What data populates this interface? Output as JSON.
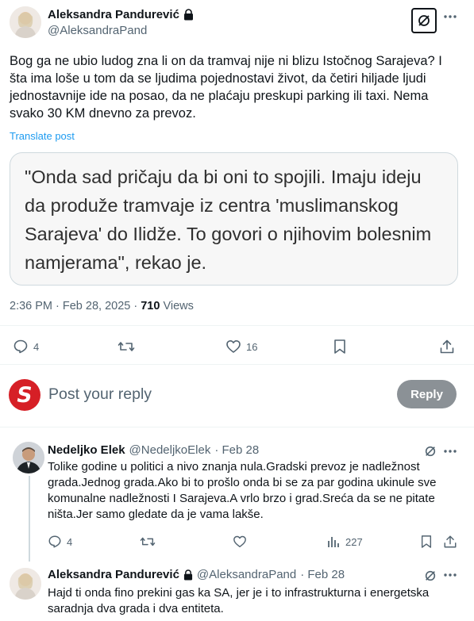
{
  "post": {
    "author_name": "Aleksandra Pandurević",
    "author_handle": "@AleksandraPand",
    "text": "Bog ga ne ubio ludog zna li on da tramvaj nije ni blizu Istočnog Sarajeva? I šta ima loše u tom da se ljudima pojednostavi život, da četiri hiljade ljudi jednostavnije ide na posao, da ne plaćaju preskupi parking ili taxi. Nema svako 30 KM dnevno za prevoz.",
    "translate_label": "Translate post",
    "quote_image_text": "\"Onda sad pričaju da bi oni to spojili. Imaju ideju da produže tramvaje iz centra 'muslimanskog Sarajeva' do Ilidže. To govori o njihovim bolesnim namjerama\", rekao je.",
    "timestamp": "2:36 PM · Feb 28, 2025 · ",
    "views_count": "710",
    "views_label": " Views",
    "replies": "4",
    "likes": "16"
  },
  "composer": {
    "placeholder": "Post your reply",
    "reply_button": "Reply",
    "avatar_letter": "S"
  },
  "replies": [
    {
      "author_name": "Nedeljko Elek",
      "author_handle": "@NedeljkoElek",
      "time": "· Feb 28",
      "text": "Tolike godine u politici a nivo znanja nula.Gradski prevoz je nadležnost grada.Jednog grada.Ako bi to prošlo onda bi se za par godina ukinule sve komunalne nadležnosti I Sarajeva.A vrlo brzo i grad.Sreća da se ne pitate ništa.Jer samo gledate da je vama lakše.",
      "replies": "4",
      "views": "227"
    },
    {
      "author_name": "Aleksandra Pandurević",
      "author_handle": "@AleksandraPand",
      "time": "· Feb 28",
      "text": "Hajd ti onda fino prekini gas ka SA, jer je i to infrastrukturna i energetska saradnja dva grada i dva entiteta."
    }
  ],
  "colors": {
    "accent": "#1d9bf0",
    "muted": "#536471",
    "divider": "#eff3f4",
    "reply_button_bg": "#8b9196",
    "logo_red": "#d61f26"
  }
}
